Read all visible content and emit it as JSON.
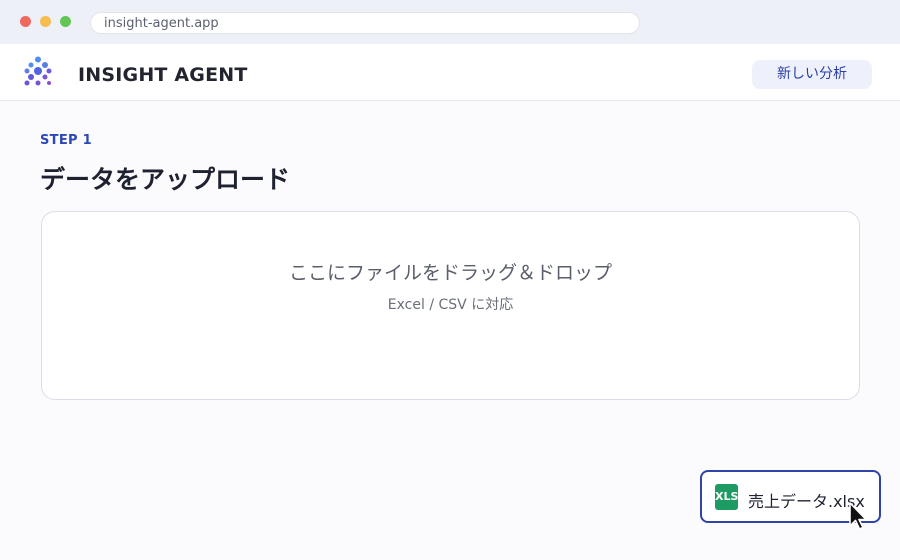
{
  "browser": {
    "url": "insight-agent.app"
  },
  "header": {
    "app_title": "INSIGHT AGENT",
    "new_analysis_label": "新しい分析",
    "logo_icon": "dots-grid-logo-icon"
  },
  "main": {
    "step_label": "STEP 1",
    "title": "データをアップロード",
    "dropzone": {
      "primary_text": "ここにファイルをドラッグ＆ドロップ",
      "secondary_text": "Excel / CSV に対応"
    }
  },
  "dragged_file": {
    "icon_text": "XLS",
    "file_name": "売上データ.xlsx"
  },
  "colors": {
    "accent": "#2d47b4",
    "excel_green": "#1e9b62"
  }
}
